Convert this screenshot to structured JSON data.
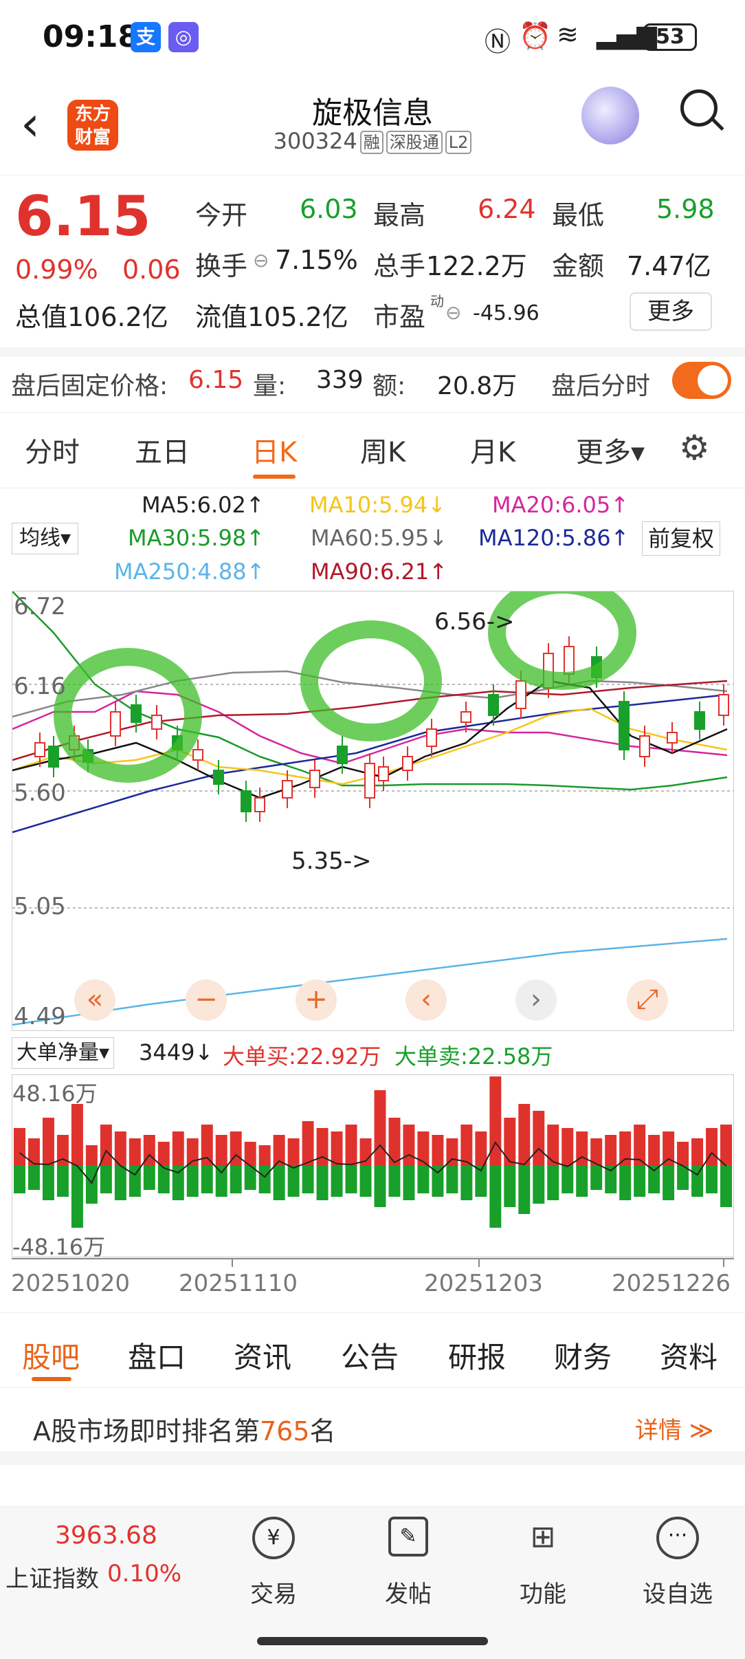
{
  "status": {
    "time": "09:18",
    "battery": "53"
  },
  "header": {
    "logo": "东方\n财富",
    "title": "旋极信息",
    "code": "300324",
    "tags": [
      "融",
      "深股通",
      "L2"
    ]
  },
  "quote": {
    "price": "6.15",
    "pct": "0.99%",
    "chg": "0.06",
    "open_l": "今开",
    "open": "6.03",
    "high_l": "最高",
    "high": "6.24",
    "low_l": "最低",
    "low": "5.98",
    "turnover_l": "换手",
    "turnover": "7.15%",
    "volume_l": "总手",
    "volume": "122.2万",
    "amount_l": "金额",
    "amount": "7.47亿",
    "mcap": "总值106.2亿",
    "float": "流值105.2亿",
    "pe_l": "市盈",
    "pe_sup": "动",
    "pe": "-45.96",
    "more": "更多"
  },
  "after": {
    "label": "盘后固定价格:",
    "price": "6.15",
    "vol_l": "量:",
    "vol": "339",
    "amt_l": "额:",
    "amt": "20.8万",
    "tick_l": "盘后分时"
  },
  "tabs": [
    "分时",
    "五日",
    "日K",
    "周K",
    "月K",
    "更多▾"
  ],
  "ma": {
    "selector": "均线▾",
    "fq": "前复权",
    "ma5": "MA5:6.02↑",
    "ma10": "MA10:5.94↓",
    "ma20": "MA20:6.05↑",
    "ma30": "MA30:5.98↑",
    "ma60": "MA60:5.95↓",
    "ma120": "MA120:5.86↑",
    "ma250": "MA250:4.88↑",
    "ma90": "MA90:6.21↑"
  },
  "colors": {
    "ma5": "#111111",
    "ma10": "#f5c518",
    "ma20": "#d6259c",
    "ma30": "#1a9a2a",
    "ma60": "#888888",
    "ma120": "#1a2a9a",
    "ma250": "#5ab4e8",
    "ma90": "#b0182a",
    "up": "#e0322d",
    "down": "#18a02a"
  },
  "chart_data": {
    "type": "candlestick",
    "y_ticks": [
      "6.72",
      "6.16",
      "5.60",
      "5.05",
      "4.49"
    ],
    "annotations": [
      "6.56->",
      "5.35->"
    ],
    "x_ticks": [
      "20251020",
      "20251110",
      "20251203",
      "20251226"
    ]
  },
  "controls": [
    "«",
    "−",
    "+",
    "‹",
    "›",
    "⤢"
  ],
  "flow": {
    "selector": "大单净量▾",
    "value": "3449↓",
    "buy": "大单买:22.92万",
    "sell": "大单卖:22.58万",
    "max": "48.16万",
    "min": "-48.16万"
  },
  "section_tabs": [
    "股吧",
    "盘口",
    "资讯",
    "公告",
    "研报",
    "财务",
    "资料"
  ],
  "rank": {
    "prefix": "A股市场即时排名第",
    "num": "765",
    "suffix": "名",
    "detail": "详情 ≫"
  },
  "nav": {
    "index_val": "3963.68",
    "index_name": "上证指数",
    "index_pct": "0.10%",
    "items": [
      "交易",
      "发帖",
      "功能",
      "设自选"
    ]
  }
}
